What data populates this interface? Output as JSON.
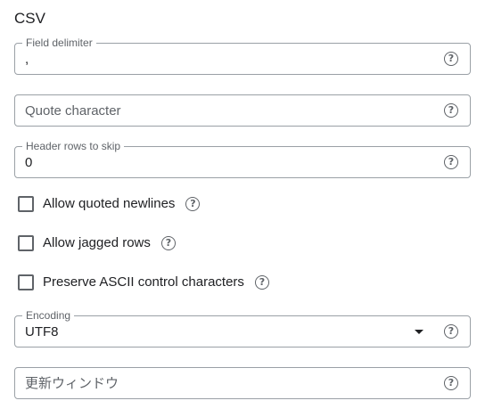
{
  "section": {
    "title": "CSV"
  },
  "field_delimiter": {
    "label": "Field delimiter",
    "value": ",",
    "help_icon": "help-circle-icon"
  },
  "quote_character": {
    "placeholder": "Quote character",
    "value": "",
    "help_icon": "help-circle-icon"
  },
  "header_rows": {
    "label": "Header rows to skip",
    "value": "0",
    "help_icon": "help-circle-icon"
  },
  "options": [
    {
      "label": "Allow quoted newlines",
      "checked": false,
      "help_icon": "help-circle-icon"
    },
    {
      "label": "Allow jagged rows",
      "checked": false,
      "help_icon": "help-circle-icon"
    },
    {
      "label": "Preserve ASCII control characters",
      "checked": false,
      "help_icon": "help-circle-icon"
    }
  ],
  "encoding": {
    "label": "Encoding",
    "value": "UTF8",
    "arrow_icon": "dropdown-arrow-icon",
    "help_icon": "help-circle-icon"
  },
  "refresh_window": {
    "placeholder": "更新ウィンドウ",
    "value": "",
    "help_icon": "help-circle-icon"
  },
  "help_glyph": "?",
  "colors": {
    "border": "#9aa0a6",
    "text": "#202124",
    "secondary_text": "#5f6368",
    "background": "#ffffff"
  }
}
